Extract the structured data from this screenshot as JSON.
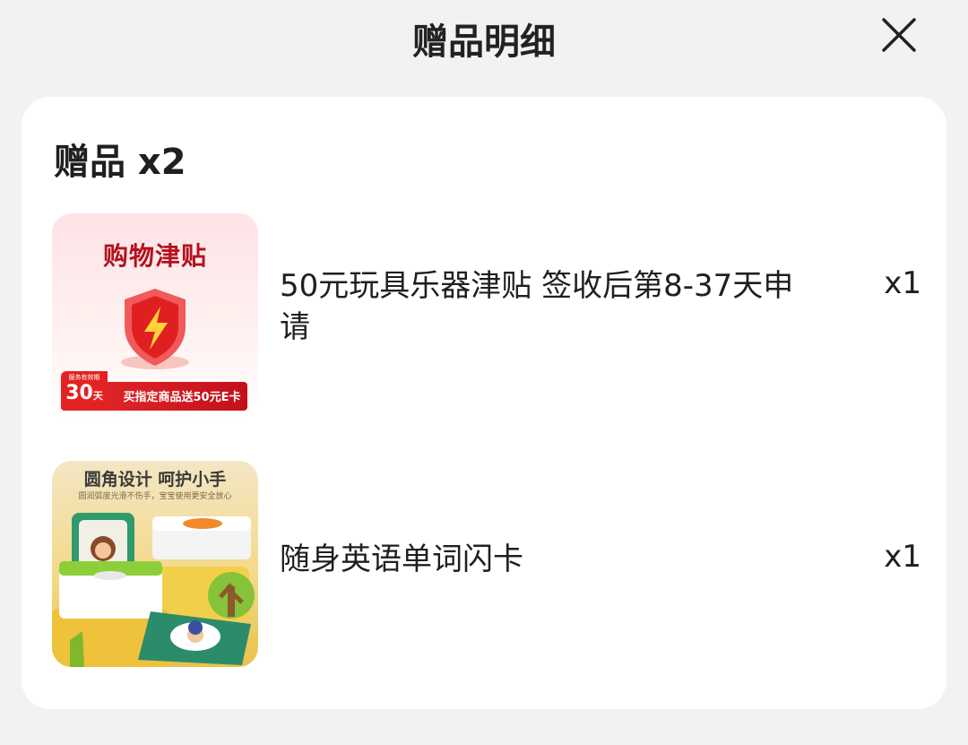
{
  "header": {
    "title": "赠品明细",
    "close_icon": "close-icon"
  },
  "gifts": {
    "title": "赠品 x2",
    "items": [
      {
        "name": "50元玩具乐器津贴 签收后第8-37天申请",
        "qty": "x1",
        "thumb": {
          "title": "购物津贴",
          "days": "30",
          "days_unit": "天",
          "days_caption": "服务有效期",
          "banner": "买指定商品送50元E卡",
          "icon": "shield-lightning-icon"
        }
      },
      {
        "name": "随身英语单词闪卡",
        "qty": "x1",
        "thumb": {
          "headline": "圆角设计 呵护小手",
          "sub": "圆润弧度光滑不伤手，宝宝使用更安全放心"
        }
      }
    ]
  },
  "colors": {
    "page_bg": "#f2f2f4",
    "card_bg": "#ffffff",
    "text": "#1f1f1f",
    "accent_red": "#e52222"
  }
}
